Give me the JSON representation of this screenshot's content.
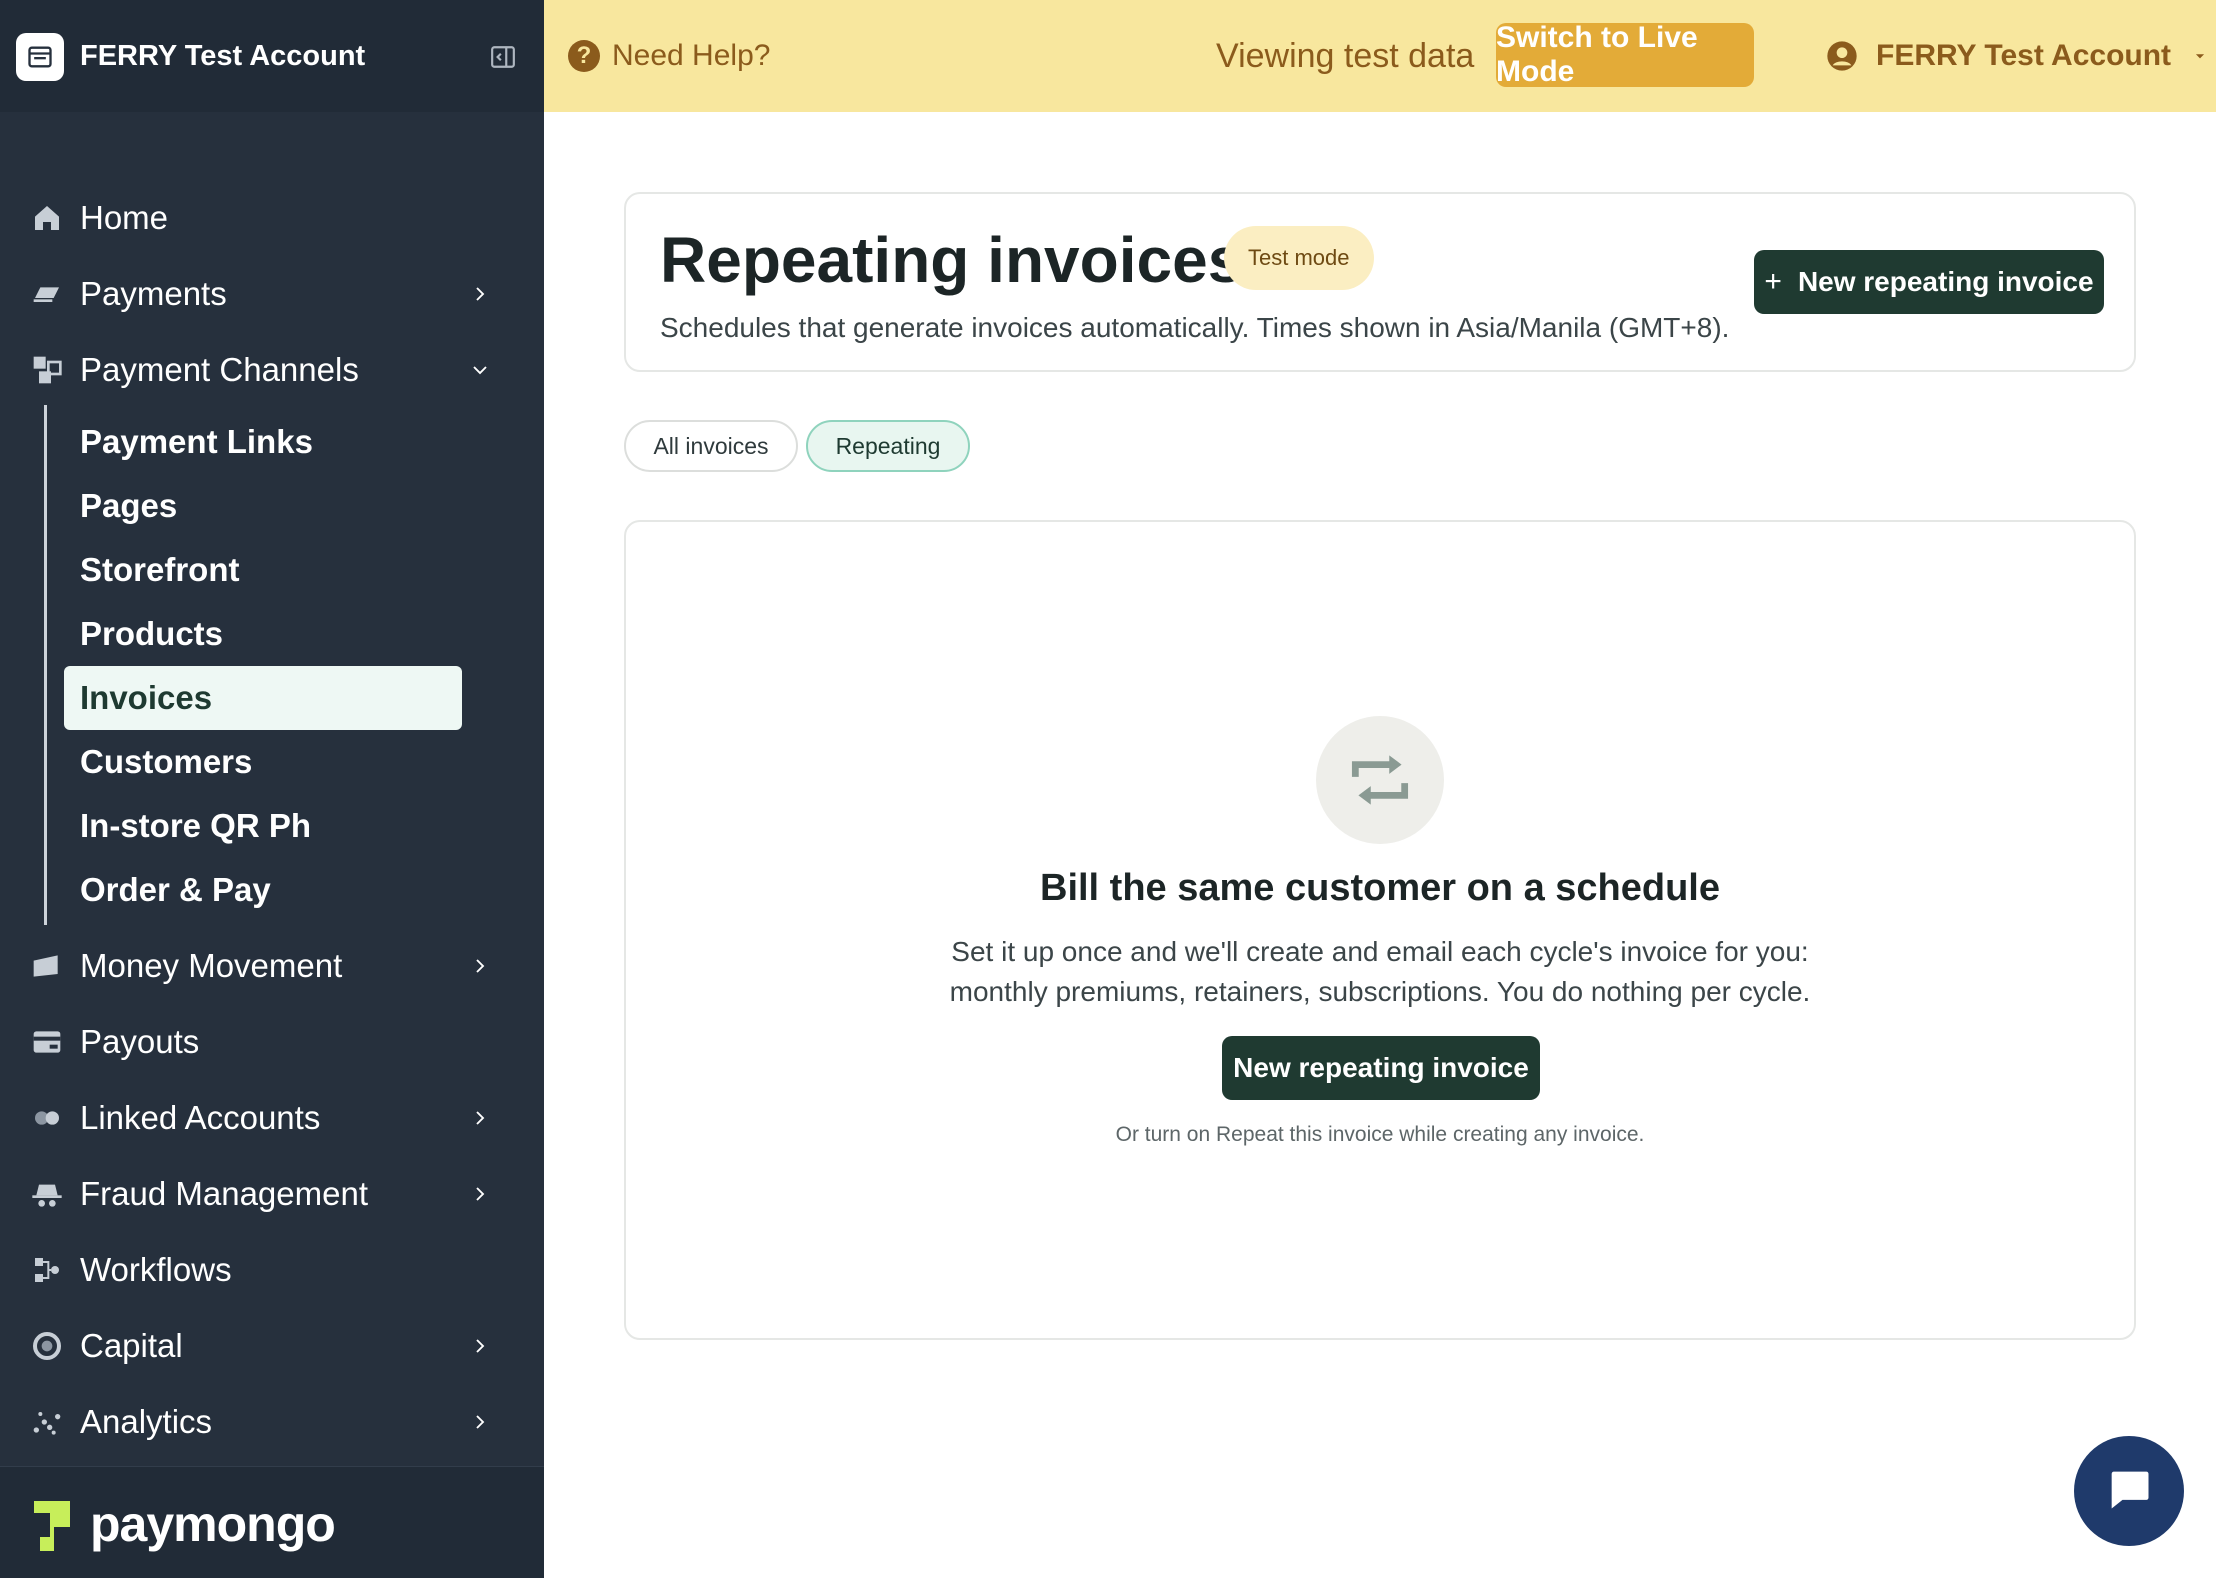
{
  "sidebar": {
    "account_name": "FERRY Test Account",
    "nav": {
      "home": "Home",
      "payments": "Payments",
      "payment_channels": "Payment Channels",
      "money_movement": "Money Movement",
      "payouts": "Payouts",
      "linked_accounts": "Linked Accounts",
      "fraud_management": "Fraud Management",
      "workflows": "Workflows",
      "capital": "Capital",
      "analytics": "Analytics"
    },
    "sub_items": [
      "Payment Links",
      "Pages",
      "Storefront",
      "Products",
      "Invoices",
      "Customers",
      "In-store QR Ph",
      "Order & Pay"
    ],
    "active_sub_item": "Invoices",
    "logo_text": "paymongo"
  },
  "topbar": {
    "help_label": "Need Help?",
    "viewing_label": "Viewing test data",
    "live_button": "Switch to Live Mode",
    "user_name": "FERRY Test Account"
  },
  "main": {
    "title": "Repeating invoices",
    "mode_badge": "Test mode",
    "subtitle": "Schedules that generate invoices automatically. Times shown in Asia/Manila (GMT+8).",
    "new_button": "New repeating invoice",
    "tabs": [
      {
        "label": "All invoices",
        "active": false
      },
      {
        "label": "Repeating",
        "active": true
      }
    ],
    "empty": {
      "title": "Bill the same customer on a schedule",
      "desc_line1": "Set it up once and we'll create and email each cycle's invoice for you:",
      "desc_line2": "monthly premiums, retainers, subscriptions. You do nothing per cycle.",
      "button": "New repeating invoice",
      "hint": "Or turn on Repeat this invoice while creating any invoice."
    }
  },
  "colors": {
    "sidebar_bg": "#26303d",
    "topbar_bg": "#f8e79e",
    "accent_dark_green": "#1f3a31",
    "live_button": "#e3ab38",
    "chat_button": "#1f3a6b"
  }
}
